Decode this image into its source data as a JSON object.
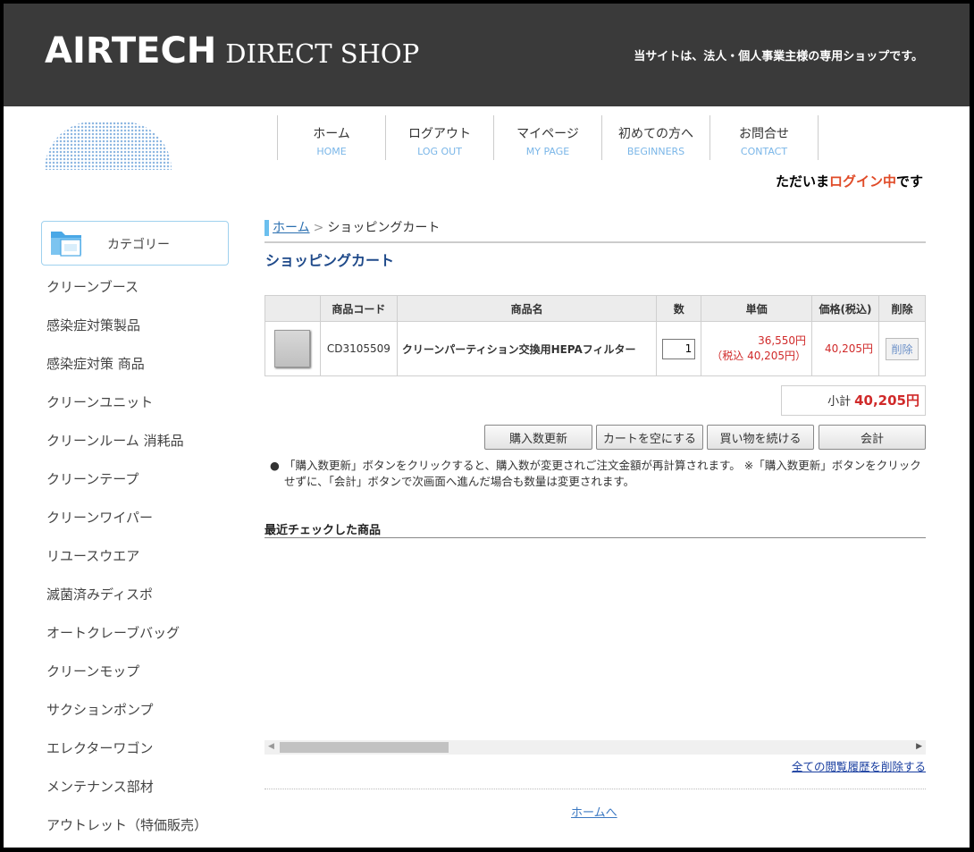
{
  "header": {
    "brand": "AIRTECH",
    "shop": "DIRECT SHOP",
    "tagline": "当サイトは、法人・個人事業主様の専用ショップです。"
  },
  "nav": [
    {
      "jp": "ホーム",
      "en": "HOME"
    },
    {
      "jp": "ログアウト",
      "en": "LOG OUT"
    },
    {
      "jp": "マイページ",
      "en": "MY PAGE"
    },
    {
      "jp": "初めての方へ",
      "en": "BEGINNERS"
    },
    {
      "jp": "お問合せ",
      "en": "CONTACT"
    }
  ],
  "login_status": {
    "pre": "ただいま",
    "highlight": "ログイン中",
    "post": "です"
  },
  "sidebar": {
    "title": "カテゴリー",
    "items": [
      "クリーンブース",
      "感染症対策製品",
      "感染症対策 商品",
      "クリーンユニット",
      "クリーンルーム 消耗品",
      "クリーンテープ",
      "クリーンワイパー",
      "リユースウエア",
      "滅菌済みディスポ",
      "オートクレーブバッグ",
      "クリーンモップ",
      "サクションポンプ",
      "エレクターワゴン",
      "メンテナンス部材",
      "アウトレット（特価販売）"
    ]
  },
  "breadcrumb": {
    "home": "ホーム",
    "separator": ">",
    "current": "ショッピングカート"
  },
  "page_title": "ショッピングカート",
  "cart": {
    "headers": [
      "",
      "商品コード",
      "商品名",
      "数",
      "単価",
      "価格(税込)",
      "削除"
    ],
    "rows": [
      {
        "code": "CD3105509",
        "name": "クリーンパーティション交換用HEPAフィルター",
        "qty": "1",
        "unit_price": "36,550円",
        "unit_price_tax": "（税込 40,205円）",
        "price": "40,205円",
        "delete_label": "削除"
      }
    ],
    "subtotal_label": "小計",
    "subtotal": "40,205円"
  },
  "actions": {
    "update": "購入数更新",
    "empty": "カートを空にする",
    "continue": "買い物を続ける",
    "checkout": "会計"
  },
  "note": "「購入数更新」ボタンをクリックすると、購入数が変更されご注文金額が再計算されます。 ※「購入数更新」ボタンをクリックせずに、「会計」ボタンで次画面へ進んだ場合も数量は変更されます。",
  "recent": {
    "title": "最近チェックした商品",
    "clear_label": "全ての閲覧履歴を削除する"
  },
  "footer": {
    "home_link": "ホームへ"
  },
  "colors": {
    "header_bg": "#3a3a3a",
    "accent_red": "#d02a2a",
    "link_blue": "#2a6fb0",
    "title_blue": "#1f4a8a"
  }
}
